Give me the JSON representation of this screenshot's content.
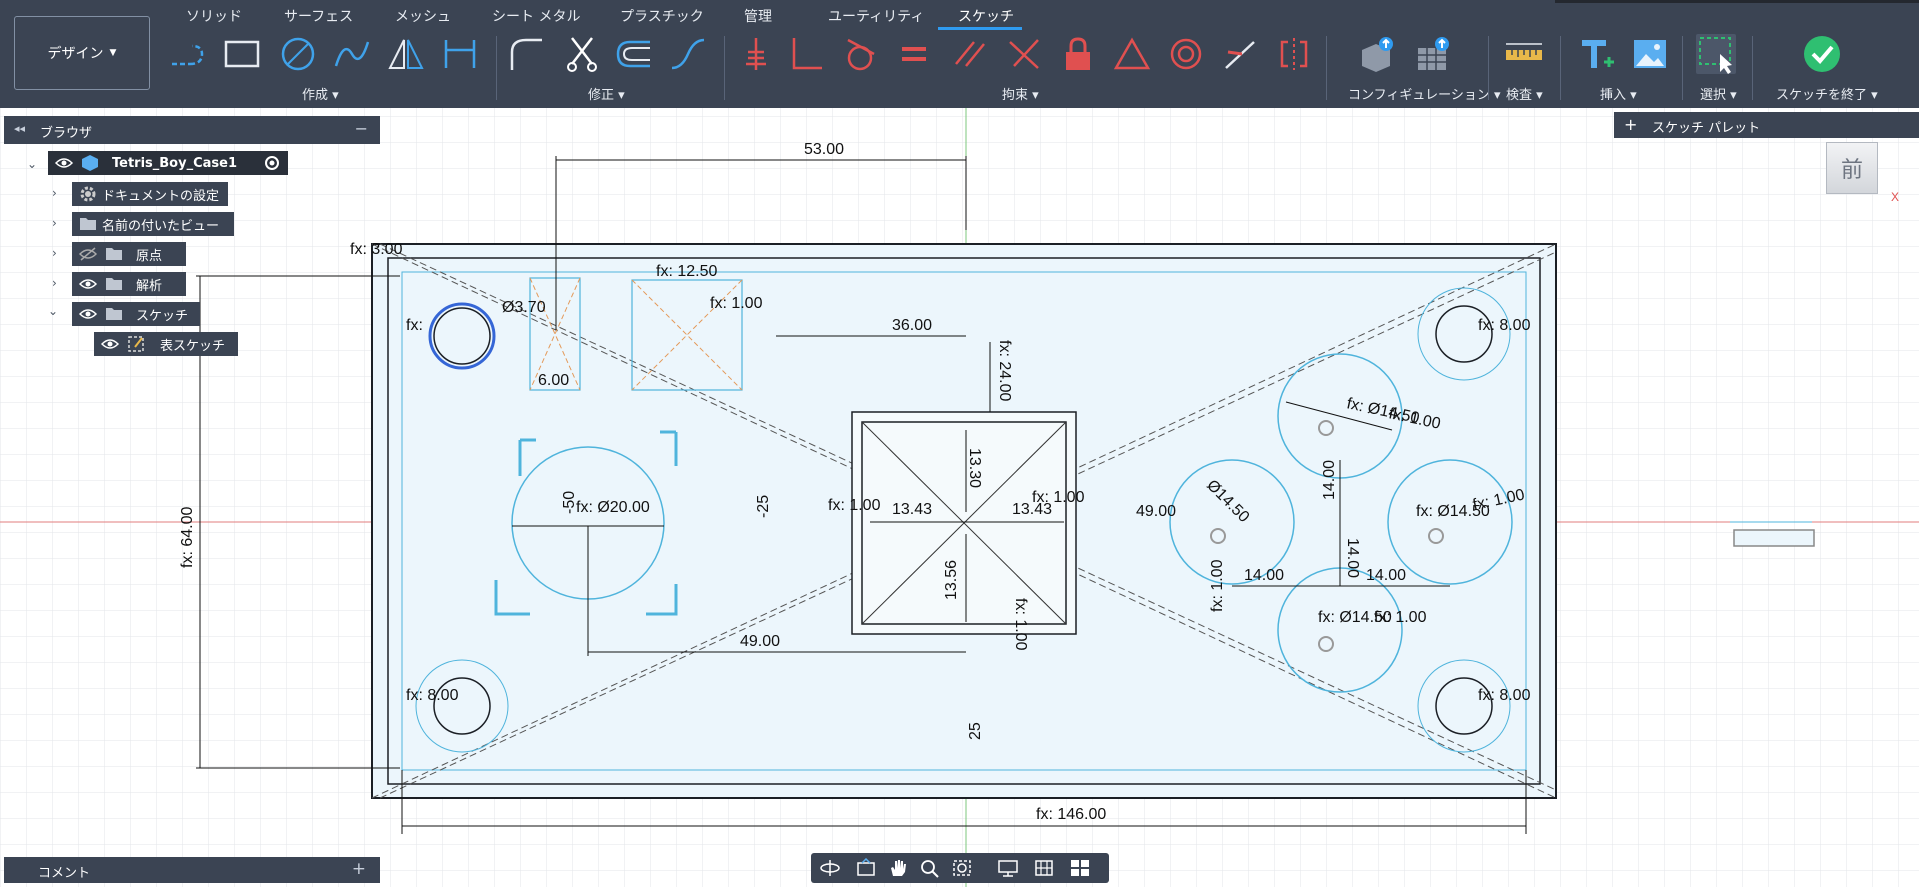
{
  "app": {
    "workspace_button": "デザイン",
    "tabs": [
      "ソリッド",
      "サーフェス",
      "メッシュ",
      "シート メタル",
      "プラスチック",
      "管理",
      "ユーティリティ",
      "スケッチ"
    ],
    "active_tab": "スケッチ",
    "groups": {
      "create": "作成",
      "modify": "修正",
      "constraints": "拘束",
      "configuration": "コンフィギュレーション",
      "inspect": "検査",
      "insert": "挿入",
      "select": "選択",
      "finish": "スケッチを終了"
    }
  },
  "browser": {
    "title": "ブラウザ",
    "root": "Tetris_Boy_Case1",
    "items": [
      "ドキュメントの設定",
      "名前の付いたビュー",
      "原点",
      "解析",
      "スケッチ"
    ],
    "sub_item": "表スケッチ"
  },
  "comment": {
    "label": "コメント"
  },
  "palette": {
    "label": "スケッチ パレット"
  },
  "view_cube": {
    "face": "前",
    "axis": "X"
  },
  "dimensions": {
    "d_53": "53.00",
    "d_fx_12_50": "fx: 12.50",
    "d_fx_1_00a": "fx: 1.00",
    "d_36": "36.00",
    "d_fx_24": "fx: 24.00",
    "d_13_30": "13.30",
    "d_fx_1_00b": "fx: 1.00",
    "d_13_43a": "13.43",
    "d_13_43b": "13.43",
    "d_fx_1_00c": "fx: 1.00",
    "d_13_56": "13.56",
    "d_fx_1_00d": "fx: 1.00",
    "d_49a": "49.00",
    "d_49b": "49.00",
    "d_fx_d20": "fx: Ø20.00",
    "d_m50": "-50",
    "d_m25": "-25",
    "d_25": "25",
    "d_fx_64": "fx: 64.00",
    "d_fx_146": "fx: 146.00",
    "d_6": "6.00",
    "d_d3_70": "Ø3.70",
    "d_fx_8a": "fx: 8.00",
    "d_fx_8b": "fx: 8.00",
    "d_fx_8c": "fx: 8.00",
    "d_fx_d14_50a": "fx: Ø14.50",
    "d_fx_d14_50b": "fx: Ø14.50",
    "d_fx_d14_50c": "fx: Ø14.50",
    "d_d14_50": "Ø14.50",
    "d_14a": "14.00",
    "d_14b": "14.00",
    "d_14c": "14.00",
    "d_14d": "14.00",
    "d_fx_1_00e": "fx: 1.00",
    "d_fx_1_00f": "fx: 1.00",
    "d_fx_1_00g": "fx: 1.00",
    "d_fx_1_00h": "fx: 1.00",
    "d_fx_3_00": "fx: 3.00",
    "d_fx_a": "fx:"
  },
  "colors": {
    "toolbar_bg": "#3b4453",
    "accent": "#2f9bf0",
    "sketch_fill": "#ecf6fc",
    "sketch_line": "#4fb4dc",
    "grid": "#e3e6ea",
    "x_axis": "#e27c7c",
    "y_axis": "#7cc77c",
    "finish_green": "#2fbf71"
  }
}
